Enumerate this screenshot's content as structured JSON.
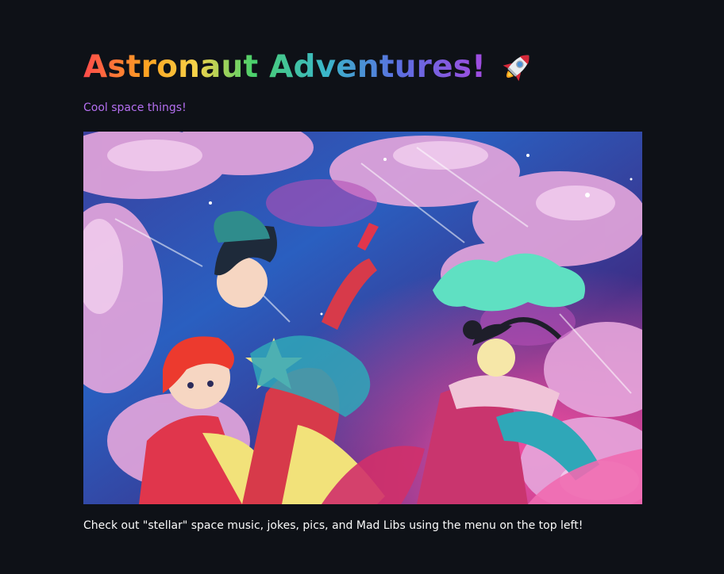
{
  "header": {
    "title": "Astronaut Adventures!",
    "title_icon": "rocket-icon",
    "subtitle": "Cool space things!"
  },
  "hero": {
    "image": "anime-space-adventurers-illustration"
  },
  "caption": "Check out \"stellar\" space music, jokes, pics, and Mad Libs using the menu on the top left!",
  "colors": {
    "background": "#0e1117",
    "subtitle": "#b46ff0",
    "text": "#fafafa"
  }
}
